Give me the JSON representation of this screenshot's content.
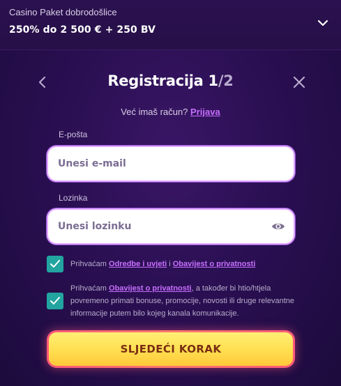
{
  "promo": {
    "title": "Casino Paket dobrodošlice",
    "offer": "250% do 2 500 € + 250 BV",
    "icon": "chevron-down-icon"
  },
  "header": {
    "title_prefix": "Registracija 1",
    "title_suffix": "/2",
    "back_icon": "chevron-left-icon",
    "close_icon": "close-icon"
  },
  "login": {
    "prompt": "Već imaš račun?",
    "link": "Prijava"
  },
  "email": {
    "label": "E-pošta",
    "placeholder": "Unesi e-mail",
    "value": ""
  },
  "password": {
    "label": "Lozinka",
    "placeholder": "Unesi lozinku",
    "value": "",
    "toggle_icon": "eye-icon"
  },
  "consents": [
    {
      "checked": true,
      "text_1": "Prihvaćam",
      "link_1": "Odredbe i uvjeti",
      "text_2": "i",
      "link_2": "Obavijest o privatnosti"
    },
    {
      "checked": true,
      "text_1": "Prihvaćam",
      "link_1": "Obavijest o privatnosti",
      "text_2": ", a također bi htio/htjela povremeno primati bonuse, promocije, novosti ili druge relevantne informacije putem bilo kojeg kanala komunikacije."
    }
  ],
  "submit": {
    "label": "SLJEDEĆI KORAK"
  },
  "colors": {
    "background": "#2a0f52",
    "accent_link": "#c86fff",
    "checkbox": "#22a4a0",
    "button_fill": "#ffe052",
    "button_border": "#ff5a7a",
    "button_text": "#7a2d12"
  }
}
